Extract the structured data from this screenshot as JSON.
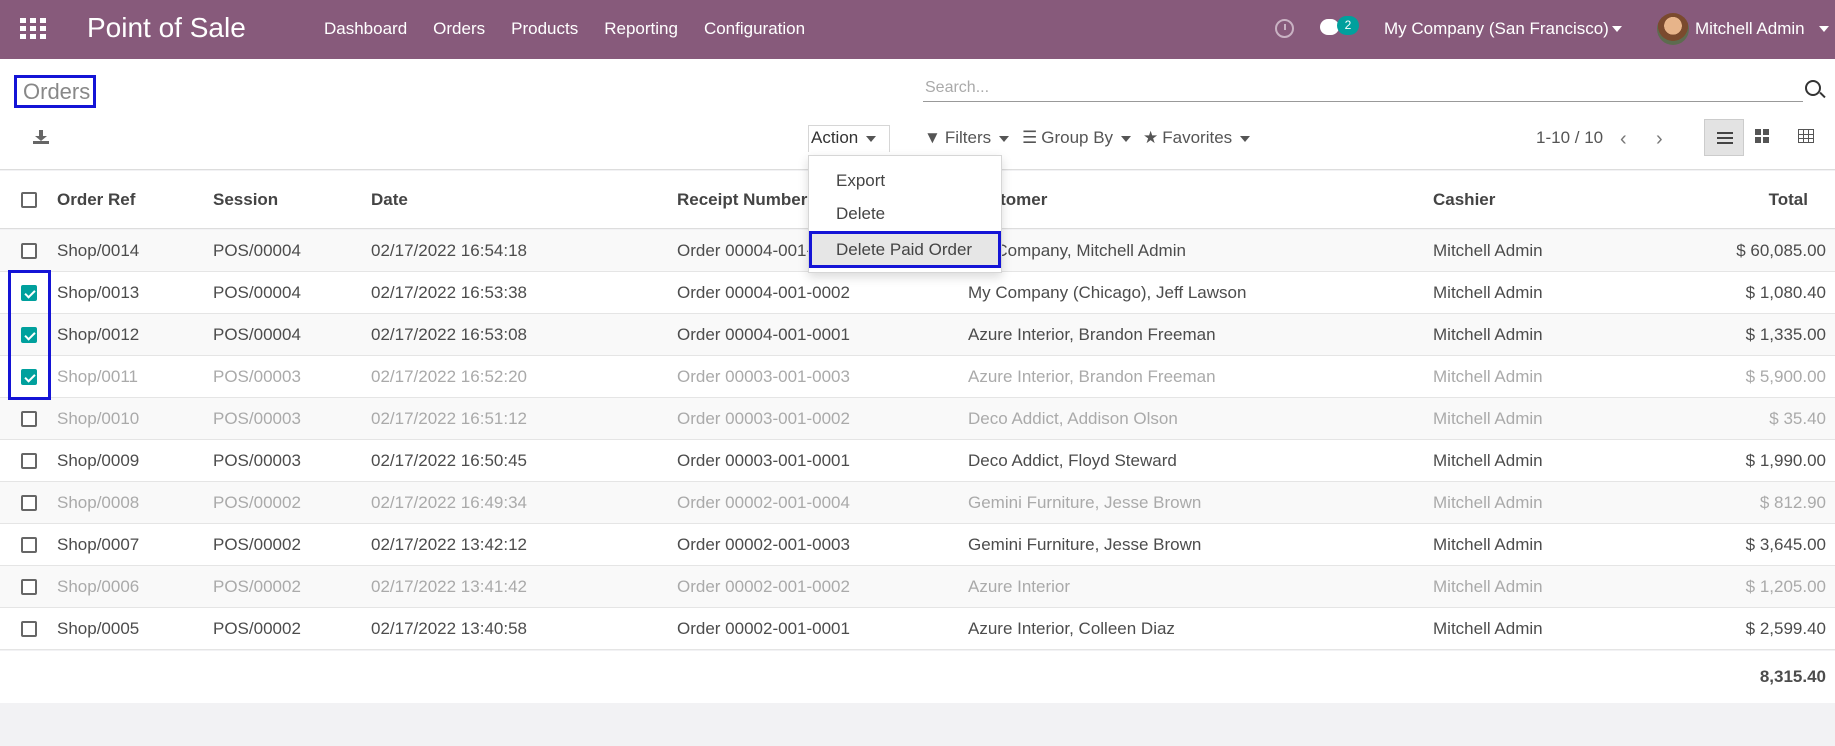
{
  "topbar": {
    "app_title": "Point of Sale",
    "menu": [
      "Dashboard",
      "Orders",
      "Products",
      "Reporting",
      "Configuration"
    ],
    "chat_count": "2",
    "company": "My Company (San Francisco)",
    "user": "Mitchell Admin",
    "brand_color": "#875a7b"
  },
  "control": {
    "page_title": "Orders",
    "search_placeholder": "Search...",
    "action_label": "Action",
    "filters_label": "Filters",
    "groupby_label": "Group By",
    "favorites_label": "Favorites",
    "pager": "1-10 / 10"
  },
  "action_menu": {
    "items": [
      "Export",
      "Delete",
      "Delete Paid Order"
    ]
  },
  "table": {
    "headers": [
      "Order Ref",
      "Session",
      "Date",
      "Receipt Number",
      "Customer",
      "Cashier",
      "Total"
    ],
    "rows": [
      {
        "ref": "Shop/0014",
        "session": "POS/00004",
        "date": "02/17/2022 16:54:18",
        "receipt": "Order 00004-001-0003",
        "customer": "My Company, Mitchell Admin",
        "cashier": "Mitchell Admin",
        "total": "$ 60,085.00",
        "checked": false,
        "muted": false
      },
      {
        "ref": "Shop/0013",
        "session": "POS/00004",
        "date": "02/17/2022 16:53:38",
        "receipt": "Order 00004-001-0002",
        "customer": "My Company (Chicago), Jeff Lawson",
        "cashier": "Mitchell Admin",
        "total": "$ 1,080.40",
        "checked": true,
        "muted": false
      },
      {
        "ref": "Shop/0012",
        "session": "POS/00004",
        "date": "02/17/2022 16:53:08",
        "receipt": "Order 00004-001-0001",
        "customer": "Azure Interior, Brandon Freeman",
        "cashier": "Mitchell Admin",
        "total": "$ 1,335.00",
        "checked": true,
        "muted": false
      },
      {
        "ref": "Shop/0011",
        "session": "POS/00003",
        "date": "02/17/2022 16:52:20",
        "receipt": "Order 00003-001-0003",
        "customer": "Azure Interior, Brandon Freeman",
        "cashier": "Mitchell Admin",
        "total": "$ 5,900.00",
        "checked": true,
        "muted": true
      },
      {
        "ref": "Shop/0010",
        "session": "POS/00003",
        "date": "02/17/2022 16:51:12",
        "receipt": "Order 00003-001-0002",
        "customer": "Deco Addict, Addison Olson",
        "cashier": "Mitchell Admin",
        "total": "$ 35.40",
        "checked": false,
        "muted": true
      },
      {
        "ref": "Shop/0009",
        "session": "POS/00003",
        "date": "02/17/2022 16:50:45",
        "receipt": "Order 00003-001-0001",
        "customer": "Deco Addict, Floyd Steward",
        "cashier": "Mitchell Admin",
        "total": "$ 1,990.00",
        "checked": false,
        "muted": false
      },
      {
        "ref": "Shop/0008",
        "session": "POS/00002",
        "date": "02/17/2022 16:49:34",
        "receipt": "Order 00002-001-0004",
        "customer": "Gemini Furniture, Jesse Brown",
        "cashier": "Mitchell Admin",
        "total": "$ 812.90",
        "checked": false,
        "muted": true
      },
      {
        "ref": "Shop/0007",
        "session": "POS/00002",
        "date": "02/17/2022 13:42:12",
        "receipt": "Order 00002-001-0003",
        "customer": "Gemini Furniture, Jesse Brown",
        "cashier": "Mitchell Admin",
        "total": "$ 3,645.00",
        "checked": false,
        "muted": false
      },
      {
        "ref": "Shop/0006",
        "session": "POS/00002",
        "date": "02/17/2022 13:41:42",
        "receipt": "Order 00002-001-0002",
        "customer": "Azure Interior",
        "cashier": "Mitchell Admin",
        "total": "$ 1,205.00",
        "checked": false,
        "muted": true
      },
      {
        "ref": "Shop/0005",
        "session": "POS/00002",
        "date": "02/17/2022 13:40:58",
        "receipt": "Order 00002-001-0001",
        "customer": "Azure Interior, Colleen Diaz",
        "cashier": "Mitchell Admin",
        "total": "$ 2,599.40",
        "checked": false,
        "muted": false
      }
    ],
    "grand_total": "8,315.40"
  }
}
